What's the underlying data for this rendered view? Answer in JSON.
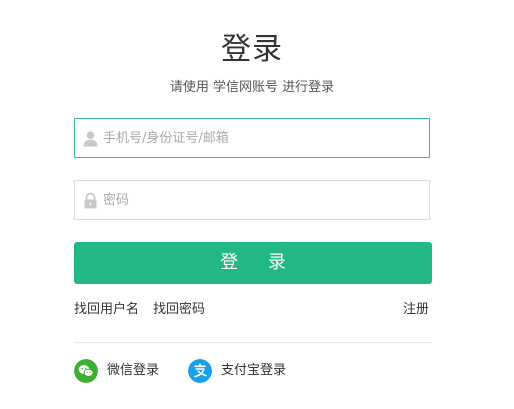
{
  "header": {
    "title": "登录",
    "subtitle": "请使用 学信网账号 进行登录"
  },
  "form": {
    "username": {
      "placeholder": "手机号/身份证号/邮箱",
      "value": "",
      "icon": "user-icon"
    },
    "password": {
      "placeholder": "密码",
      "value": "",
      "icon": "lock-icon"
    },
    "submit_label": "登 录"
  },
  "links": {
    "find_username": "找回用户名",
    "find_password": "找回密码",
    "register": "注册"
  },
  "social": {
    "wechat": {
      "label": "微信登录",
      "icon": "wechat-icon",
      "color": "#3cb034"
    },
    "alipay": {
      "label": "支付宝登录",
      "icon": "alipay-icon",
      "color": "#1aa0e8"
    }
  },
  "colors": {
    "accent": "#22b884",
    "focus_border": "#3dbd94",
    "border": "#dddddd",
    "divider": "#e8e8e8"
  }
}
